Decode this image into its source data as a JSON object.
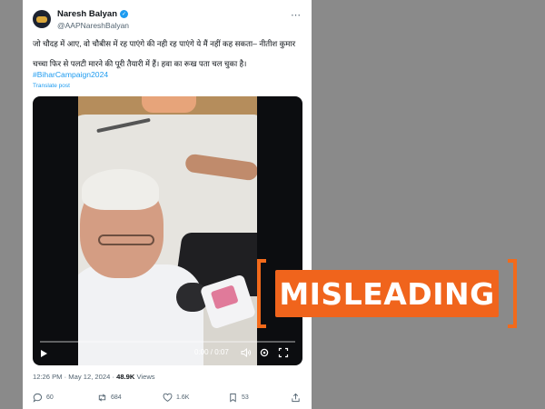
{
  "tweet": {
    "display_name": "Naresh Balyan",
    "handle": "@AAPNareshBalyan",
    "text_line1": "जो चौदह में आए, वो चौबीस में रह पाएंगे की नही रह पाएंगे ये मैं नहीं कह सकता– नीतीश कुमार",
    "text_line2": "चच्चा फिर से पलटी मारने की पूरी तैयारी में हैं। हवा का रूख पता चल चुका है।",
    "hashtag": "#BiharCampaign2024",
    "translate_label": "Translate post",
    "time": "12:26 PM",
    "separator": "·",
    "date": "May 12, 2024",
    "views_count": "48.9K",
    "views_label": "Views"
  },
  "video": {
    "time_display": "0:00 / 0:07",
    "progress": 0.0
  },
  "actions": {
    "replies": "60",
    "reposts": "684",
    "likes": "1.6K",
    "bookmarks": "53"
  },
  "stamp": {
    "label": "MISLEADING",
    "color": "#f0641c"
  },
  "icons": [
    "verified-badge-icon",
    "more-options-icon",
    "play-icon",
    "volume-icon",
    "settings-icon",
    "fullscreen-icon",
    "reply-icon",
    "repost-icon",
    "like-icon",
    "bookmark-icon",
    "share-icon"
  ]
}
